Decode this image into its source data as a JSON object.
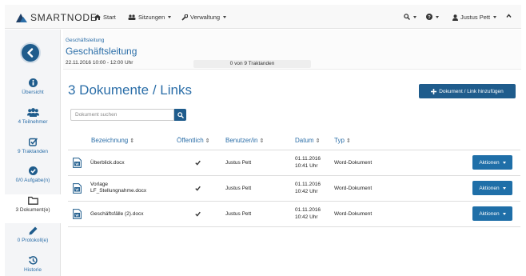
{
  "app": {
    "brand": "SMARTNODE"
  },
  "nav": {
    "start": "Start",
    "sitzungen": "Sitzungen",
    "verwaltung": "Verwaltung",
    "user": "Justus Pett"
  },
  "sidebar": {
    "items": [
      {
        "label": "Übersicht"
      },
      {
        "label": "4 Teilnehmer"
      },
      {
        "label": "9 Traktanden"
      },
      {
        "label": "0/0 Aufgabe(n)"
      },
      {
        "label": "3 Dokument(e)"
      },
      {
        "label": "0 Protokoll(e)"
      },
      {
        "label": "Historie"
      }
    ]
  },
  "meeting": {
    "breadcrumb": "Geschäftsleitung",
    "title": "Geschäftsleitung",
    "datetime": "22.11.2016 10:00 - 12:00 Uhr",
    "progress_text": "0 von 9 Traktanden",
    "progress": 0
  },
  "main": {
    "title": "3 Dokumente / Links",
    "add_button": "Dokument / Link hinzufügen",
    "search_placeholder": "Dokument suchen"
  },
  "table": {
    "headers": {
      "name": "Bezeichnung",
      "public": "Öffentlich",
      "user": "Benutzer/in",
      "date": "Datum",
      "type": "Typ"
    },
    "action_label": "Aktionen",
    "rows": [
      {
        "name": "Überblick.docx",
        "public": true,
        "user": "Justus Pett",
        "date": "01.11.2016",
        "time": "10:41 Uhr",
        "type": "Word-Dokument"
      },
      {
        "name": "Vorlage LF_Stellungnahme.docx",
        "public": true,
        "user": "Justus Pett",
        "date": "01.11.2016",
        "time": "10:42 Uhr",
        "type": "Word-Dokument"
      },
      {
        "name": "Geschäftsfälle (2).docx",
        "public": true,
        "user": "Justus Pett",
        "date": "01.11.2016",
        "time": "10:42 Uhr",
        "type": "Word-Dokument"
      }
    ]
  },
  "colors": {
    "primary": "#1f5c8c",
    "link": "#2b6ea8",
    "action": "#1f6fa8"
  },
  "icons": {
    "brand": "smartnode-logo-icon",
    "start": "home-icon",
    "sitzungen": "group-icon",
    "verwaltung": "wrench-icon",
    "search": "search-icon",
    "help": "question-icon",
    "user": "user-icon",
    "collapse": "chevron-up-icon",
    "back": "chevron-left-icon",
    "document": "word-document-icon"
  }
}
